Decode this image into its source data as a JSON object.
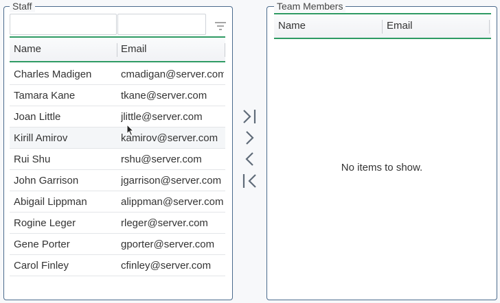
{
  "staff": {
    "legend": "Staff",
    "filter": {
      "name_value": "",
      "email_value": ""
    },
    "columns": {
      "name": "Name",
      "email": "Email"
    },
    "rows": [
      {
        "name": "Charles Madigen",
        "email": "cmadigan@server.com"
      },
      {
        "name": "Tamara Kane",
        "email": "tkane@server.com"
      },
      {
        "name": "Joan Little",
        "email": "jlittle@server.com"
      },
      {
        "name": "Kirill Amirov",
        "email": "kamirov@server.com"
      },
      {
        "name": "Rui Shu",
        "email": "rshu@server.com"
      },
      {
        "name": "John Garrison",
        "email": "jgarrison@server.com"
      },
      {
        "name": "Abigail Lippman",
        "email": "alippman@server.com"
      },
      {
        "name": "Rogine Leger",
        "email": "rleger@server.com"
      },
      {
        "name": "Gene Porter",
        "email": "gporter@server.com"
      },
      {
        "name": "Carol Finley",
        "email": "cfinley@server.com"
      }
    ]
  },
  "team": {
    "legend": "Team Members",
    "columns": {
      "name": "Name",
      "email": "Email"
    },
    "empty_text": "No items to show."
  },
  "movers": {
    "icons": [
      "move-all-right-icon",
      "move-right-icon",
      "move-left-icon",
      "move-all-left-icon"
    ]
  },
  "colors": {
    "accent": "#2e9a63",
    "border": "#4a6a8c",
    "icon": "#5f6b78"
  }
}
